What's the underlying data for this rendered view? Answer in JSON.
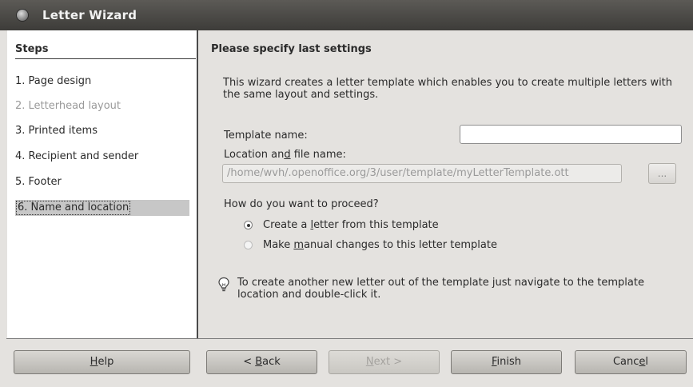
{
  "window": {
    "title": "Letter Wizard"
  },
  "steps": {
    "header": "Steps",
    "items": [
      {
        "label": "1. Page design",
        "state": "normal"
      },
      {
        "label": "2. Letterhead layout",
        "state": "disabled"
      },
      {
        "label": "3. Printed items",
        "state": "normal"
      },
      {
        "label": "4. Recipient and sender",
        "state": "normal"
      },
      {
        "label": "5. Footer",
        "state": "normal"
      },
      {
        "label": "6. Name and location",
        "state": "selected"
      }
    ]
  },
  "main": {
    "heading": "Please specify last settings",
    "intro": "This wizard creates a letter template which enables you to create multiple letters with the same layout and settings.",
    "template_name_label": "Template name:",
    "template_name_value": "",
    "location_label_pre": "Location an",
    "location_label_mnemonic": "d",
    "location_label_post": " file name:",
    "location_value": "/home/wvh/.openoffice.org/3/user/template/myLetterTemplate.ott",
    "browse_label": "...",
    "proceed_question": "How do you want to proceed?",
    "option_create_pre": "Create a ",
    "option_create_mnemonic": "l",
    "option_create_post": "etter from this template",
    "option_create_checked": true,
    "option_manual_pre": "Make ",
    "option_manual_mnemonic": "m",
    "option_manual_post": "anual changes to this letter template",
    "option_manual_checked": false,
    "tip_icon": "lightbulb-icon",
    "tip_text": "To create another new letter out of the template just navigate to the template location and double-click it."
  },
  "buttons": {
    "help_mnemonic": "H",
    "help_rest": "elp",
    "back_pre": "< ",
    "back_mnemonic": "B",
    "back_rest": "ack",
    "next_mnemonic": "N",
    "next_rest": "ext >",
    "next_enabled": false,
    "finish_mnemonic": "F",
    "finish_rest": "inish",
    "cancel_pre": "Canc",
    "cancel_mnemonic": "e",
    "cancel_rest": "l"
  },
  "colors": {
    "titlebar": "#3d3c39",
    "dialog_background": "#e4e2df",
    "selected_step": "#c7c7c7"
  }
}
